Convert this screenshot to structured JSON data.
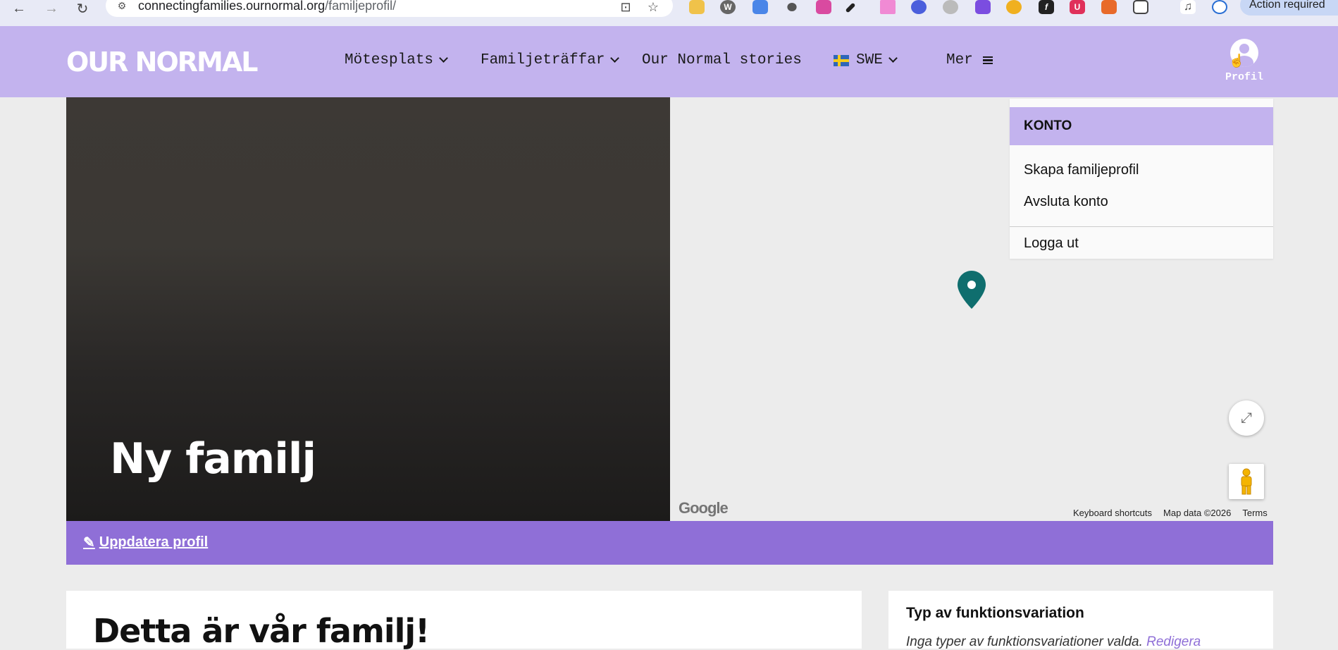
{
  "browser": {
    "url_host": "connectingfamilies.ournormal.org",
    "url_path": "/familjeprofil/",
    "action_required": "Action required"
  },
  "header": {
    "logo": "OUR NORMAL",
    "nav": [
      {
        "label": "Mötesplats",
        "has_dropdown": true
      },
      {
        "label": "Familjeträffar",
        "has_dropdown": true
      },
      {
        "label": "Our Normal stories",
        "has_dropdown": false
      },
      {
        "label": "SWE",
        "has_dropdown": true
      },
      {
        "label": "Mer",
        "has_dropdown": false
      }
    ],
    "profile_label": "Profil"
  },
  "hero": {
    "title": "Ny familj"
  },
  "map": {
    "attribution": [
      "Keyboard shortcuts",
      "Map data ©2026",
      "Terms"
    ],
    "logo": "Google"
  },
  "account_menu": {
    "heading": "KONTO",
    "items": [
      "Skapa familjeprofil",
      "Avsluta konto",
      "Logga ut"
    ]
  },
  "update_bar": {
    "link": "Uppdatera profil"
  },
  "main": {
    "heading": "Detta är vår familj!"
  },
  "sidebar": {
    "heading": "Typ av funktionsvariation",
    "note": "Inga typer av funktionsvariationer valda.",
    "edit_link": "Redigera"
  },
  "colors": {
    "header_bg": "#c3b3ee",
    "accent": "#8f6fd7",
    "map_pin": "#0f6e6e"
  }
}
